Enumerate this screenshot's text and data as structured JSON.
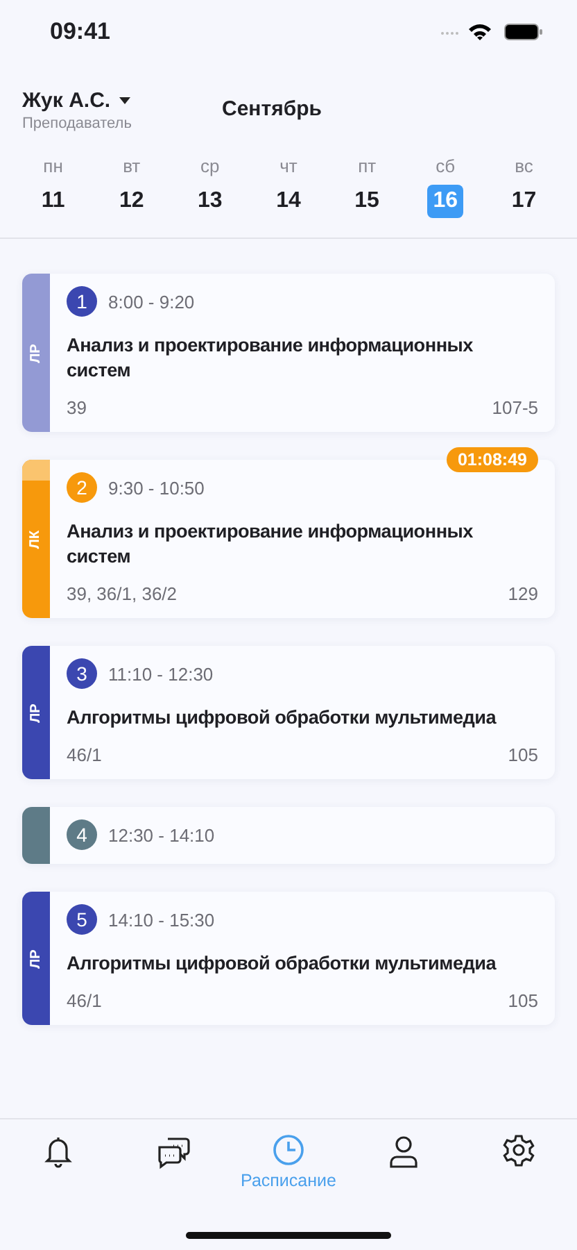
{
  "status_bar": {
    "time": "09:41"
  },
  "header": {
    "user": "Жук А.С.",
    "role": "Преподаватель",
    "month": "Сентябрь"
  },
  "days": [
    {
      "weekday": "пн",
      "date": "11",
      "selected": false
    },
    {
      "weekday": "вт",
      "date": "12",
      "selected": false
    },
    {
      "weekday": "ср",
      "date": "13",
      "selected": false
    },
    {
      "weekday": "чт",
      "date": "14",
      "selected": false
    },
    {
      "weekday": "пт",
      "date": "15",
      "selected": false
    },
    {
      "weekday": "сб",
      "date": "16",
      "selected": true
    },
    {
      "weekday": "вс",
      "date": "17",
      "selected": false
    }
  ],
  "lessons": [
    {
      "kind": "lesson",
      "number": "1",
      "time": "8:00 - 9:20",
      "type": "ЛР",
      "color": "#3b47b0",
      "past": true,
      "title": "Анализ и проектирование информационных систем",
      "groups": "39",
      "room": "107-5"
    },
    {
      "kind": "lesson",
      "number": "2",
      "time": "9:30 - 10:50",
      "type": "ЛК",
      "color": "#f7990c",
      "past": false,
      "timer": "01:08:49",
      "title": "Анализ и проектирование информационных систем",
      "groups": "39, 36/1, 36/2",
      "room": "129"
    },
    {
      "kind": "lesson",
      "number": "3",
      "time": "11:10 - 12:30",
      "type": "ЛР",
      "color": "#3b47b0",
      "past": false,
      "title": "Алгоритмы цифровой обработки мультимедиа",
      "groups": "46/1",
      "room": "105"
    },
    {
      "kind": "break",
      "number": "4",
      "time": "12:30 - 14:10",
      "color": "#5e7b87",
      "past": false
    },
    {
      "kind": "lesson",
      "number": "5",
      "time": "14:10 - 15:30",
      "type": "ЛР",
      "color": "#3b47b0",
      "past": false,
      "title": "Алгоритмы цифровой обработки мультимедиа",
      "groups": "46/1",
      "room": "105"
    }
  ],
  "tab_bar": [
    {
      "selected": false
    },
    {
      "selected": false
    },
    {
      "label": "Расписание",
      "selected": true
    },
    {
      "selected": false
    },
    {
      "selected": false
    }
  ]
}
